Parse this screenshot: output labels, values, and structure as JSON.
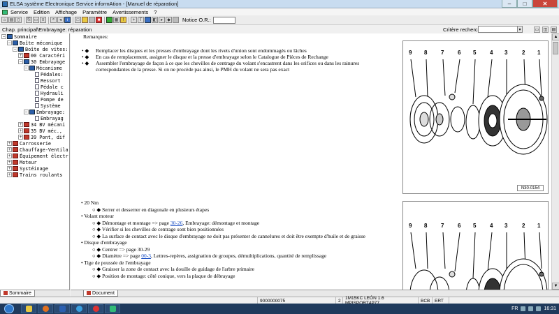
{
  "window": {
    "title": "ELSA système Electronique Service informAtion - [Manuel de réparation]",
    "min": "–",
    "max": "□",
    "close": "✕"
  },
  "menu": [
    "Service",
    "Edition",
    "Affichage",
    "Paramètre",
    "Avertissements",
    "?"
  ],
  "toolbar": {
    "notice_label": "Notice O.R.:",
    "notice_value": ""
  },
  "breadcrumb": {
    "path": "Chap. principal\\Embrayage: réparation",
    "search_label": "Critère recherche:",
    "search_value": ""
  },
  "tree": [
    {
      "label": "Sommaire",
      "level": 0,
      "exp": "−",
      "icon": "open"
    },
    {
      "label": "Boîte mécanique",
      "level": 1,
      "exp": "−",
      "icon": "open"
    },
    {
      "label": "Boîte de vites:",
      "level": 2,
      "exp": "−",
      "icon": "open"
    },
    {
      "label": "00 Caractéri",
      "level": 3,
      "exp": "+",
      "icon": "closed"
    },
    {
      "label": "30 Embrayage",
      "level": 3,
      "exp": "−",
      "icon": "open"
    },
    {
      "label": "Mécanisme",
      "level": 4,
      "exp": "−",
      "icon": "open"
    },
    {
      "label": "Pédales:",
      "level": 5,
      "exp": "",
      "icon": "doc"
    },
    {
      "label": "Ressort",
      "level": 5,
      "exp": "",
      "icon": "doc"
    },
    {
      "label": "Pédale c",
      "level": 5,
      "exp": "",
      "icon": "doc"
    },
    {
      "label": "Hydrauli",
      "level": 5,
      "exp": "",
      "icon": "doc"
    },
    {
      "label": "Pompe de",
      "level": 5,
      "exp": "",
      "icon": "doc"
    },
    {
      "label": "Système",
      "level": 5,
      "exp": "",
      "icon": "doc"
    },
    {
      "label": "Embrayage:",
      "level": 4,
      "exp": "−",
      "icon": "open"
    },
    {
      "label": "Embrayag",
      "level": 5,
      "exp": "",
      "icon": "doc"
    },
    {
      "label": "34 BV mécani",
      "level": 3,
      "exp": "+",
      "icon": "closed"
    },
    {
      "label": "35 BV méc.,",
      "level": 3,
      "exp": "+",
      "icon": "closed"
    },
    {
      "label": "39 Pont, dif",
      "level": 3,
      "exp": "+",
      "icon": "closed"
    },
    {
      "label": "Carrosserie",
      "level": 1,
      "exp": "+",
      "icon": "closed"
    },
    {
      "label": "Chauffage-Ventila",
      "level": 1,
      "exp": "+",
      "icon": "closed"
    },
    {
      "label": "Équipement électr",
      "level": 1,
      "exp": "+",
      "icon": "closed"
    },
    {
      "label": "Moteur",
      "level": 1,
      "exp": "+",
      "icon": "closed"
    },
    {
      "label": "Systéinage",
      "level": 1,
      "exp": "+",
      "icon": "closed"
    },
    {
      "label": "Trains roulants",
      "level": 1,
      "exp": "+",
      "icon": "closed"
    }
  ],
  "tabs": {
    "sidebar": "Sommaire",
    "content": "Document"
  },
  "document": {
    "remarks_title": "Remarques:",
    "remarks": [
      "Remplacer les disques et les presses d'embrayage dont les rivets d'union sont endommagés ou lâches",
      "En cas de remplacement, assigner le disque et la presse d'embrayage selon le Catalogue de Pièces de Rechange",
      "Assembler l'embrayage de façon à ce que les chevilles de centrage du volant s'encastrent dans les orifices ou dans les rainures correspondantes de la presse. Si on ne procède pas ainsi, le PMH du volant ne sera pas exact"
    ],
    "items": [
      {
        "title": "20 Nm",
        "subs": [
          {
            "text": "Serrer et desserrer en diagonale en plusieurs étapes"
          }
        ]
      },
      {
        "title": "Volant moteur",
        "subs": [
          {
            "pre": "Démontage et montage => page ",
            "link": "30-26",
            "post": ", Embrayage: démontage et montage"
          },
          {
            "text": "Vérifier si les chevilles de centrage sont bien positionnées"
          },
          {
            "text": "La surface de contact avec le disque d'embrayage ne doit pas présenter de cannelures et doit être exempte d'huile et de graisse"
          }
        ]
      },
      {
        "title": "Disque d'embrayage",
        "subs": [
          {
            "text": "Centrer => page 30-29"
          },
          {
            "pre": "Diamètre => page ",
            "link": "00-3",
            "post": ", Lettres-repères, assignation de groupes, démultiplications, quantité de remplissage"
          }
        ]
      },
      {
        "title": "Tige de poussée de l'embrayage",
        "subs": [
          {
            "text": "Graisser la zone de contact avec la douille de guidage de l'arbre primaire"
          },
          {
            "text": "Position de montage: côté conique, vers la plaque de débrayage"
          }
        ]
      }
    ]
  },
  "figure": {
    "numbers": [
      "9",
      "8",
      "7",
      "6",
      "5",
      "4",
      "3",
      "2",
      "1"
    ],
    "ref": "N30-0154"
  },
  "status": {
    "code": "9000000075",
    "cell1": "2",
    "vehicle": "1M15KC  LEÓN 1.6 MPISPORT4P77",
    "engine": "BCB",
    "box": "ERT"
  },
  "taskbar": {
    "lang": "FR",
    "time": "16:31"
  },
  "colors": {
    "link": "#1a4fc4",
    "book_closed": "#c0392b",
    "book_open": "#2c5ea8",
    "taskbar": "#1f3a5c"
  }
}
